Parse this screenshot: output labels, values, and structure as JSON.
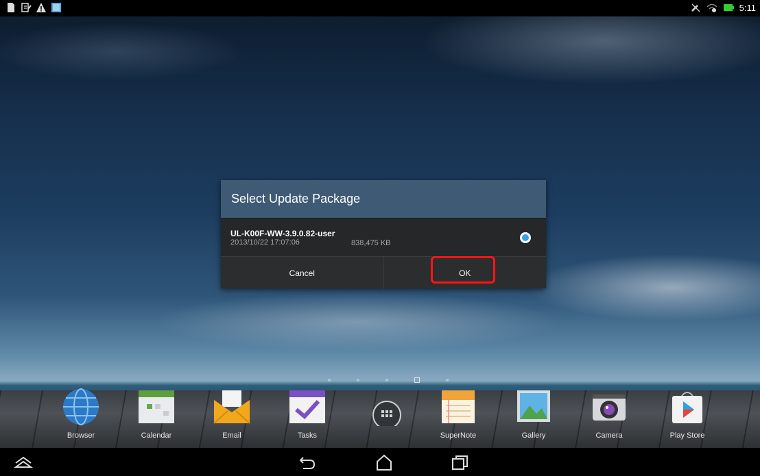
{
  "status_bar": {
    "left_icons": [
      "notification-sd-icon",
      "notification-update-icon",
      "warning-icon",
      "notification-image-icon"
    ],
    "right_icons": [
      "mute-icon",
      "wifi-icon",
      "battery-icon"
    ],
    "time": "5:11"
  },
  "dialog": {
    "title": "Select Update Package",
    "package": {
      "name": "UL-K00F-WW-3.9.0.82-user",
      "date": "2013/10/22 17:07:06",
      "size": "838,475 KB",
      "selected": true
    },
    "cancel_label": "Cancel",
    "ok_label": "OK",
    "highlight_color": "#ff1414",
    "title_bar_color": "#3e5a74",
    "radio_color": "#33a2e8"
  },
  "home": {
    "pages": 5,
    "current_page": 4
  },
  "dock": {
    "items": [
      {
        "label": "Browser",
        "icon": "globe-icon"
      },
      {
        "label": "Calendar",
        "icon": "calendar-icon"
      },
      {
        "label": "Email",
        "icon": "envelope-icon"
      },
      {
        "label": "Tasks",
        "icon": "checkmark-icon"
      },
      {
        "label": "",
        "icon": "app-drawer-icon"
      },
      {
        "label": "SuperNote",
        "icon": "notepad-icon"
      },
      {
        "label": "Gallery",
        "icon": "picture-icon"
      },
      {
        "label": "Camera",
        "icon": "camera-icon"
      },
      {
        "label": "Play Store",
        "icon": "play-store-icon"
      }
    ]
  },
  "nav_bar": {
    "buttons": [
      "recent-apps-up-icon",
      "back-icon",
      "home-icon",
      "recents-icon"
    ]
  }
}
